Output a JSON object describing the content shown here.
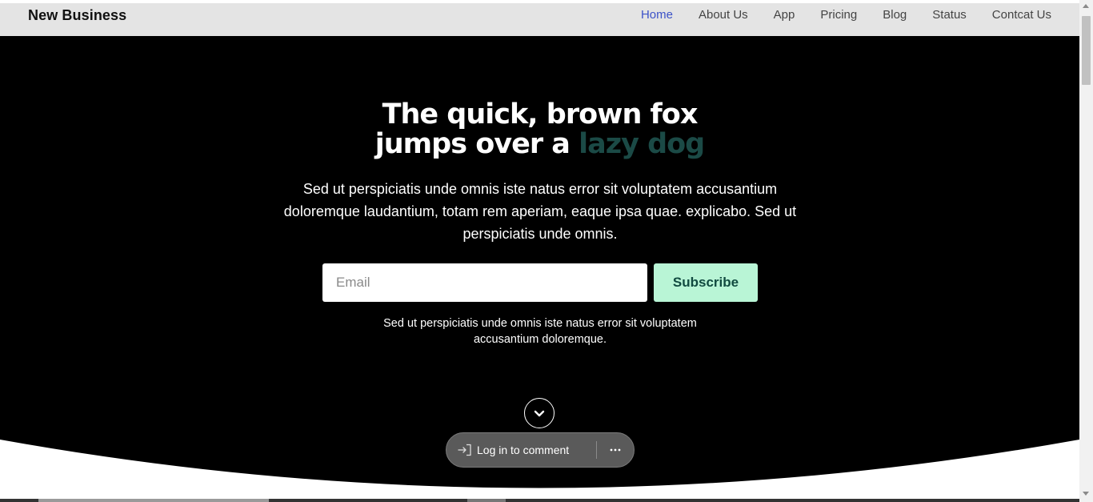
{
  "nav": {
    "brand": "New Business",
    "links": [
      "Home",
      "About Us",
      "App",
      "Pricing",
      "Blog",
      "Status",
      "Contcat Us"
    ],
    "active_index": 0
  },
  "hero": {
    "headline_line1": "The quick, brown fox",
    "headline_line2_prefix": "jumps over a ",
    "headline_line2_accent": "lazy dog",
    "lead": "Sed ut perspiciatis unde omnis iste natus error sit voluptatem accusantium doloremque laudantium, totam rem aperiam, eaque ipsa quae. explicabo. Sed ut perspiciatis unde omnis.",
    "email_placeholder": "Email",
    "email_value": "",
    "subscribe_label": "Subscribe",
    "small_note": "Sed ut perspiciatis unde omnis iste natus error sit voluptatem accusantium doloremque."
  },
  "comment_bar": {
    "login_label": "Log in to comment",
    "login_icon": "login-icon",
    "more_icon": "more-horizontal-icon"
  },
  "icons": {
    "scroll_down": "chevron-down-icon"
  },
  "colors": {
    "nav_background": "#e4e4e4",
    "nav_active": "#3c52c8",
    "hero_background": "#000000",
    "headline_accent": "#1b4a46",
    "subscribe_background": "#b9f5d6",
    "subscribe_text": "#114a40"
  }
}
